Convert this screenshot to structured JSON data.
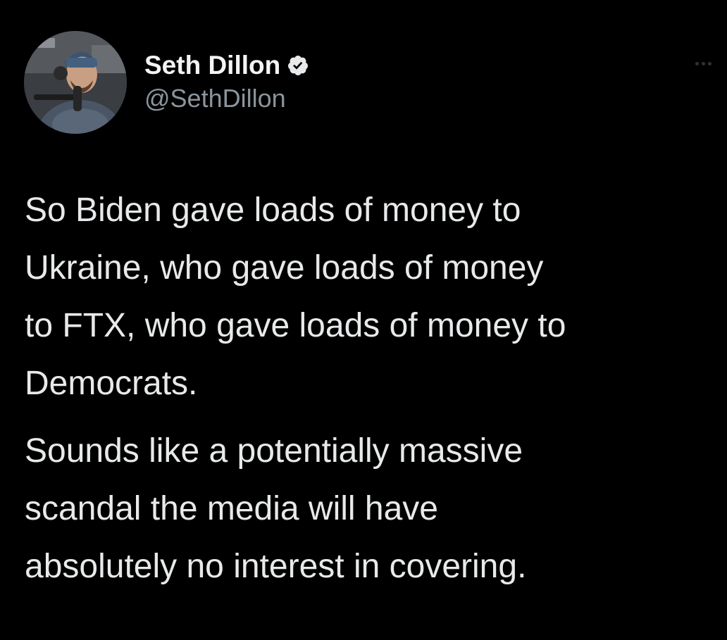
{
  "tweet": {
    "author": {
      "display_name": "Seth Dillon",
      "handle": "@SethDillon",
      "verified": true,
      "avatar_icon": "avatar-photo"
    },
    "more_icon": "more-dots-icon",
    "paragraphs": [
      "So Biden gave loads of money to\nUkraine, who gave loads of money\nto FTX, who gave loads of money to\nDemocrats.",
      "Sounds like a potentially massive\nscandal the media will have\nabsolutely no interest in covering."
    ]
  },
  "colors": {
    "background": "#000000",
    "text": "#e7e9ea",
    "secondary_text": "#8b949b",
    "verified_badge": "#e7e9ea"
  }
}
